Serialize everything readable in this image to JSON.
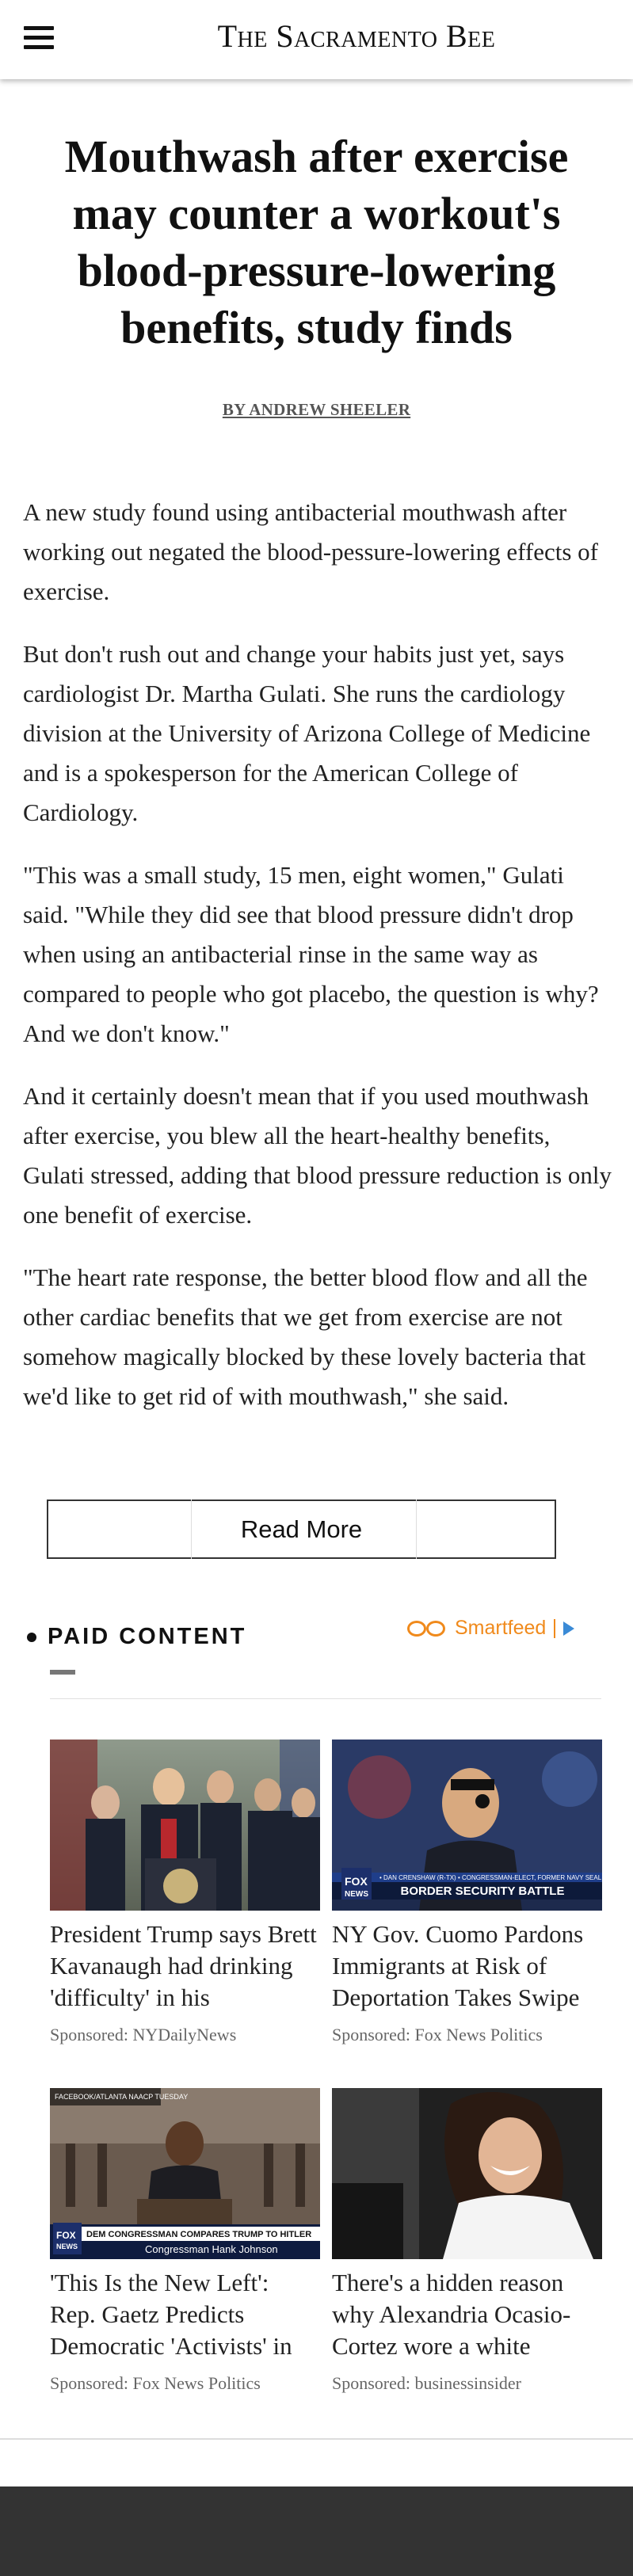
{
  "header": {
    "masthead": "The Sacramento Bee",
    "menu_icon": "hamburger-menu-icon"
  },
  "article": {
    "headline": "Mouthwash after exercise may counter a workout's blood-pressure-lowering benefits, study finds",
    "byline": "BY ANDREW SHEELER",
    "paragraphs": [
      "A new study found using antibacterial mouthwash after working out negated the blood-pessure-lowering effects of exercise.",
      "But don't rush out and change your habits just yet, says cardiologist Dr. Martha Gulati. She runs the cardiology division at the University of Arizona College of Medicine and is a spokesperson for the American College of Cardiology.",
      "\"This was a small study, 15 men, eight women,\" Gulati said. \"While they did see that blood pressure didn't drop when using an antibacterial rinse in the same way as compared to people who got placebo, the question is why? And we don't know.\"",
      "And it certainly doesn't mean that if you used mouthwash after exercise, you blew all the heart-healthy benefits, Gulati stressed, adding that blood pressure reduction is only one benefit of exercise.",
      "\"The heart rate response, the better blood flow and all the other cardiac benefits that we get from exercise are not somehow magically blocked by these lovely bacteria that we'd like to get rid of with mouthwash,\" she said."
    ],
    "read_more_label": "Read More"
  },
  "paid_content": {
    "title": "PAID CONTENT",
    "provider": "Smartfeed",
    "colors": {
      "provider": "#f08a1c",
      "adchoices": "#3a8ad6"
    },
    "cards": [
      {
        "title": "President Trump says Brett Kavanaugh had drinking 'difficulty' in his",
        "source": "Sponsored: NYDailyNews",
        "image_overlay": ""
      },
      {
        "title": "NY Gov. Cuomo Pardons Immigrants at Risk of Deportation Takes Swipe",
        "source": "Sponsored: Fox News Politics",
        "image_overlay": "BORDER SECURITY BATTLE",
        "image_ticker": "• DAN CRENSHAW (R-TX) • CONGRESSMAN-ELECT, FORMER NAVY SEAL"
      },
      {
        "title": "'This Is the New Left': Rep. Gaetz Predicts Democratic 'Activists' in",
        "source": "Sponsored: Fox News Politics",
        "image_overlay": "DEM CONGRESSMAN COMPARES TRUMP TO HITLER",
        "image_ticker": "Congressman Hank Johnson",
        "image_corner": "FACEBOOK/ATLANTA NAACP TUESDAY"
      },
      {
        "title": "There's a hidden reason why Alexandria Ocasio-Cortez wore a white",
        "source": "Sponsored: businessinsider",
        "image_overlay": ""
      }
    ]
  }
}
